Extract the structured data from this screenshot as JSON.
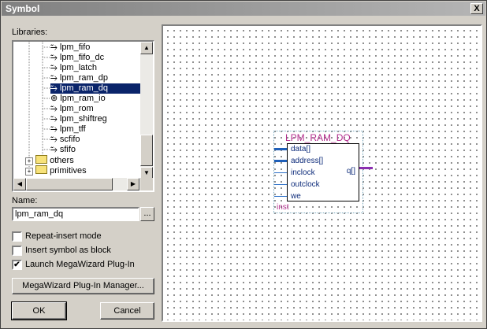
{
  "window": {
    "title": "Symbol",
    "close_label": "X"
  },
  "libraries": {
    "label": "Libraries:",
    "items": [
      {
        "label": "lpm_fifo",
        "type": "symbol"
      },
      {
        "label": "lpm_fifo_dc",
        "type": "symbol"
      },
      {
        "label": "lpm_latch",
        "type": "symbol"
      },
      {
        "label": "lpm_ram_dp",
        "type": "symbol"
      },
      {
        "label": "lpm_ram_dq",
        "type": "symbol",
        "selected": true
      },
      {
        "label": "lpm_ram_io",
        "type": "symbol"
      },
      {
        "label": "lpm_rom",
        "type": "symbol"
      },
      {
        "label": "lpm_shiftreg",
        "type": "symbol"
      },
      {
        "label": "lpm_tff",
        "type": "symbol"
      },
      {
        "label": "scfifo",
        "type": "symbol"
      },
      {
        "label": "sfifo",
        "type": "symbol"
      },
      {
        "label": "others",
        "type": "folder"
      },
      {
        "label": "primitives",
        "type": "folder"
      }
    ]
  },
  "name": {
    "label": "Name:",
    "value": "lpm_ram_dq",
    "browse_label": "..."
  },
  "options": {
    "repeat_insert": {
      "label": "Repeat-insert mode",
      "checked": false
    },
    "insert_as_block": {
      "label": "Insert symbol as block",
      "checked": false
    },
    "launch_megawizard": {
      "label": "Launch MegaWizard Plug-In",
      "checked": true,
      "mark": "✔"
    }
  },
  "buttons": {
    "megawizard_manager": "MegaWizard Plug-In Manager...",
    "ok": "OK",
    "cancel": "Cancel"
  },
  "symbol": {
    "title": "LPM_RAM_DQ",
    "inputs": [
      "data[]",
      "address[]",
      "inclock",
      "outclock",
      "we"
    ],
    "output": "q[]",
    "instance_label": "inst"
  },
  "colors": {
    "selection": "#0a246a",
    "symbol_title": "#b22c8c",
    "port_text": "#0d2b7a",
    "bus": "#1f5fb8",
    "output_bus": "#8b2fb0"
  }
}
